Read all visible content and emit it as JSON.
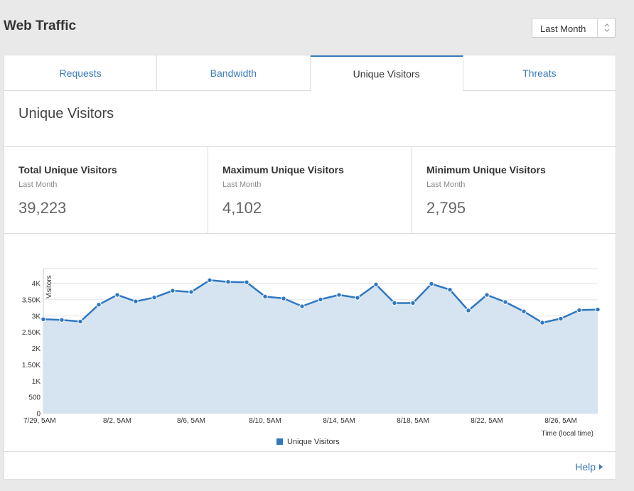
{
  "page": {
    "title": "Web Traffic",
    "range_select": {
      "selected": "Last Month"
    }
  },
  "tabs": [
    {
      "label": "Requests",
      "active": false
    },
    {
      "label": "Bandwidth",
      "active": false
    },
    {
      "label": "Unique Visitors",
      "active": true
    },
    {
      "label": "Threats",
      "active": false
    }
  ],
  "section": {
    "title": "Unique Visitors"
  },
  "stats": [
    {
      "label": "Total Unique Visitors",
      "period": "Last Month",
      "value": "39,223"
    },
    {
      "label": "Maximum Unique Visitors",
      "period": "Last Month",
      "value": "4,102"
    },
    {
      "label": "Minimum Unique Visitors",
      "period": "Last Month",
      "value": "2,795"
    }
  ],
  "footer": {
    "help_label": "Help"
  },
  "colors": {
    "accent": "#3a7bbf",
    "series_line": "#2f78c0",
    "series_fill": "#d6e4f1"
  },
  "chart_data": {
    "type": "area",
    "ylabel": "Visitors",
    "xlabel": "Time (local time)",
    "ylim": [
      0,
      4000
    ],
    "y_ticks": [
      "0",
      "500",
      "1K",
      "1.50K",
      "2K",
      "2.50K",
      "3K",
      "3.50K",
      "4K"
    ],
    "x_tick_labels": [
      "7/29, 5AM",
      "8/2, 5AM",
      "8/6, 5AM",
      "8/10, 5AM",
      "8/14, 5AM",
      "8/18, 5AM",
      "8/22, 5AM",
      "8/26, 5AM"
    ],
    "x": [
      "7/29",
      "7/30",
      "7/31",
      "8/1",
      "8/2",
      "8/3",
      "8/4",
      "8/5",
      "8/6",
      "8/7",
      "8/8",
      "8/9",
      "8/10",
      "8/11",
      "8/12",
      "8/13",
      "8/14",
      "8/15",
      "8/16",
      "8/17",
      "8/18",
      "8/19",
      "8/20",
      "8/21",
      "8/22",
      "8/23",
      "8/24",
      "8/25",
      "8/26",
      "8/27",
      "8/28"
    ],
    "grid": true,
    "legend_position": "bottom",
    "series": [
      {
        "name": "Unique Visitors",
        "values": [
          2900,
          2880,
          2830,
          3350,
          3650,
          3450,
          3570,
          3780,
          3740,
          4102,
          4050,
          4040,
          3600,
          3540,
          3300,
          3510,
          3650,
          3560,
          3970,
          3400,
          3400,
          3990,
          3810,
          3170,
          3650,
          3430,
          3140,
          2795,
          2920,
          3180,
          3200
        ]
      }
    ]
  }
}
